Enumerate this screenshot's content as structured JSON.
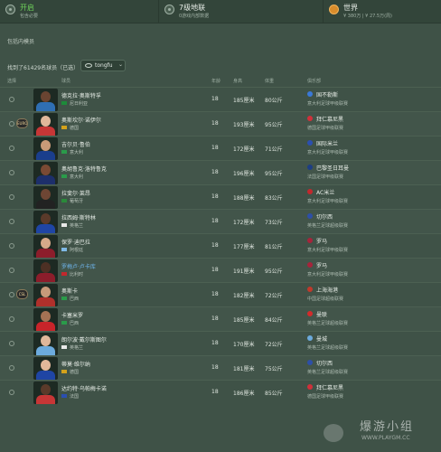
{
  "filters": {
    "status": {
      "title": "开启",
      "sub": "包含必要"
    },
    "transfer": {
      "title": "7级地联",
      "sub": "0游戏内部数据"
    },
    "region": {
      "title": "世界",
      "sub": "¥ 380万 | ¥ 27.5万(周)"
    }
  },
  "section_label": "包括内模员",
  "results_text": "找到了61429名球员（已选）",
  "search": {
    "value": "tongfu"
  },
  "columns": {
    "select": "选择",
    "player": "球员",
    "age": "年龄",
    "height": "身高",
    "weight": "体重",
    "club": "俱乐部"
  },
  "rows": [
    {
      "badge": "",
      "name": "德克拉·奥斯特孚",
      "nation": "尼日利亚",
      "flag_color": "#1d8a3a",
      "age": "18",
      "height": "185厘米",
      "weight": "80公斤",
      "club": "国不勒斯",
      "club_color": "#3a79d8",
      "league": "意大利足球甲级联赛",
      "skin": "#6a4431",
      "kit": "#2f6fb3",
      "link": false
    },
    {
      "badge": "EURO",
      "name": "奥斯坎尔·诺伊尔",
      "nation": "德国",
      "flag_color": "#d4a21b",
      "age": "18",
      "height": "193厘米",
      "weight": "95公斤",
      "club": "拜仁慕尼黑",
      "club_color": "#d0303a",
      "league": "德国足球甲级联赛",
      "skin": "#e0b79a",
      "kit": "#c73636",
      "link": false
    },
    {
      "badge": "",
      "name": "吉尔贝·鲁伯",
      "nation": "意大利",
      "flag_color": "#2a9b4a",
      "age": "18",
      "height": "172厘米",
      "weight": "71公斤",
      "club": "国际米兰",
      "club_color": "#2b4fb0",
      "league": "意大利足球甲级联赛",
      "skin": "#c99a78",
      "kit": "#1a3e8c",
      "link": false
    },
    {
      "badge": "",
      "name": "奥胡鲁克·洛特鲁克",
      "nation": "意大利",
      "flag_color": "#2a9b4a",
      "age": "18",
      "height": "196厘米",
      "weight": "95公斤",
      "club": "巴黎圣日耳曼",
      "club_color": "#1d3e84",
      "league": "法国足球甲级联赛",
      "skin": "#7a4a34",
      "kit": "#1d2f6b",
      "link": false
    },
    {
      "badge": "",
      "name": "拉斐尔·莱昂",
      "nation": "葡萄牙",
      "flag_color": "#2a8a3a",
      "age": "18",
      "height": "188厘米",
      "weight": "83公斤",
      "club": "AC米兰",
      "club_color": "#c2282d",
      "league": "意大利足球甲级联赛",
      "skin": "#6e4634",
      "kit": "#222222",
      "link": false
    },
    {
      "badge": "",
      "name": "拉西姆·斯特林",
      "nation": "英格兰",
      "flag_color": "#e9e9e9",
      "age": "18",
      "height": "172厘米",
      "weight": "73公斤",
      "club": "切尔西",
      "club_color": "#2d4fa8",
      "league": "英格兰足球超级联赛",
      "skin": "#5a3a2a",
      "kit": "#1f45a4",
      "link": false
    },
    {
      "badge": "",
      "name": "保罗·迪巴拉",
      "nation": "阿根廷",
      "flag_color": "#7fb9e6",
      "age": "18",
      "height": "177厘米",
      "weight": "81公斤",
      "club": "罗马",
      "club_color": "#a6243b",
      "league": "意大利足球甲级联赛",
      "skin": "#d6a98a",
      "kit": "#8c1d2b",
      "link": false
    },
    {
      "badge": "",
      "name": "罗梅卢·卢卡库",
      "nation": "比利时",
      "flag_color": "#c2282d",
      "age": "18",
      "height": "191厘米",
      "weight": "95公斤",
      "club": "罗马",
      "club_color": "#a6243b",
      "league": "意大利足球甲级联赛",
      "skin": "#4d3024",
      "kit": "#8c1d2b",
      "link": true
    },
    {
      "badge": "CSL",
      "name": "奥斯卡",
      "nation": "巴西",
      "flag_color": "#2a9b4a",
      "age": "18",
      "height": "182厘米",
      "weight": "72公斤",
      "club": "上海海港",
      "club_color": "#c0392b",
      "league": "中国足球超级联赛",
      "skin": "#c79a7a",
      "kit": "#b0302b",
      "link": false
    },
    {
      "badge": "",
      "name": "卡塞米罗",
      "nation": "巴西",
      "flag_color": "#2a9b4a",
      "age": "18",
      "height": "185厘米",
      "weight": "84公斤",
      "club": "曼联",
      "club_color": "#d32b2b",
      "league": "英格兰足球超级联赛",
      "skin": "#a47254",
      "kit": "#c8242a",
      "link": false
    },
    {
      "badge": "",
      "name": "朗尔波·戴尔斯图尔",
      "nation": "英格兰",
      "flag_color": "#e9e9e9",
      "age": "18",
      "height": "170厘米",
      "weight": "72公斤",
      "club": "曼城",
      "club_color": "#6cabdd",
      "league": "英格兰足球超级联赛",
      "skin": "#e0b79a",
      "kit": "#6cabdd",
      "link": false
    },
    {
      "badge": "",
      "name": "蒂莫·维尔纳",
      "nation": "德国",
      "flag_color": "#d4a21b",
      "age": "18",
      "height": "181厘米",
      "weight": "75公斤",
      "club": "切尔西",
      "club_color": "#2d4fa8",
      "league": "英格兰足球超级联赛",
      "skin": "#e2b89a",
      "kit": "#1f45a4",
      "link": false
    },
    {
      "badge": "",
      "name": "达约特·乌帕梅卡诺",
      "nation": "法国",
      "flag_color": "#2b4fb0",
      "age": "18",
      "height": "186厘米",
      "weight": "85公斤",
      "club": "拜仁慕尼黑",
      "club_color": "#d0303a",
      "league": "德国足球甲级联赛",
      "skin": "#5a3a2a",
      "kit": "#c73636",
      "link": false
    }
  ],
  "watermark": {
    "brand": "爆游小组",
    "url": "WWW.PLAYGM.CC"
  }
}
